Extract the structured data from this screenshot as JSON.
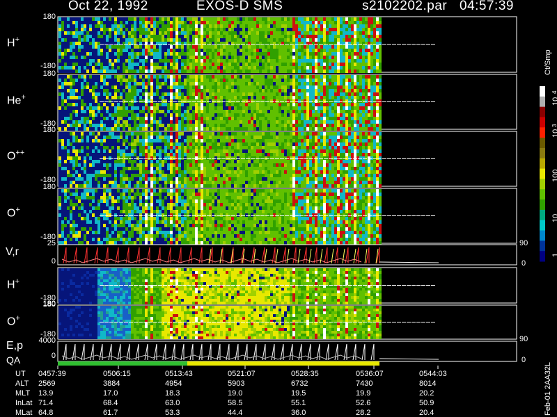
{
  "header": {
    "date": "Oct 22, 1992",
    "instrument": "EXOS-D SMS",
    "file": "s2102202.par",
    "time": "04:57:39"
  },
  "panels": [
    {
      "label": "H",
      "sup": "+",
      "top": "180",
      "bottom": "-180"
    },
    {
      "label": "He",
      "sup": "+",
      "top": "180",
      "bottom": "-180"
    },
    {
      "label": "O",
      "sup": "++",
      "top": "180",
      "bottom": "-180"
    },
    {
      "label": "O",
      "sup": "+",
      "top": "180",
      "bottom": "-180"
    },
    {
      "label": "V,r",
      "sup": "",
      "top": "25",
      "bottom": "0"
    },
    {
      "label": "H",
      "sup": "+",
      "top": "180",
      "bottom": "-180"
    },
    {
      "label": "O",
      "sup": "+",
      "top": "180",
      "bottom": "-180"
    },
    {
      "label": "E,p",
      "sup": "",
      "top": "4000",
      "bottom": "0"
    }
  ],
  "qa_label": "QA",
  "right_axis": {
    "vr_top": "90",
    "vr_bottom": "0",
    "ep_top": "90",
    "ep_bottom": "0"
  },
  "colorbar": {
    "unit": "Ct/Smp",
    "ticks": [
      "10",
      "4",
      "10",
      "3",
      "100",
      "10",
      "1"
    ],
    "colors": [
      "#ffffff",
      "#b0b0b0",
      "#8b0000",
      "#cc0000",
      "#ff2000",
      "#6b5a00",
      "#8a7a10",
      "#b8a800",
      "#e8e800",
      "#a0d000",
      "#60c000",
      "#30a000",
      "#00aa80",
      "#00c8c8",
      "#0088cc",
      "#003399",
      "#000080"
    ]
  },
  "footer_code": "Feb-01 2AA32L",
  "chart_data": {
    "type": "heatmap",
    "title": "Oct 22, 1992   EXOS-D SMS",
    "x_rows": {
      "labels": [
        "UT",
        "ALT",
        "MLT",
        "InLat",
        "MLat"
      ],
      "columns": [
        [
          "0457:39",
          "0506:15",
          "0513:43",
          "0521:07",
          "0528:35",
          "0536:07",
          "0544:03"
        ],
        [
          "2569",
          "3884",
          "4954",
          "5903",
          "6732",
          "7430",
          "8014"
        ],
        [
          "13.9",
          "17.0",
          "18.3",
          "19.0",
          "19.5",
          "19.9",
          "20.2"
        ],
        [
          "71.4",
          "68.4",
          "63.0",
          "58.5",
          "55.1",
          "52.6",
          "50.9"
        ],
        [
          "64.8",
          "61.7",
          "53.3",
          "44.4",
          "36.0",
          "28.2",
          "20.4"
        ]
      ]
    },
    "yrange_pitch": [
      -180,
      180
    ],
    "vr_range": [
      0,
      25
    ],
    "ep_range": [
      0,
      4000
    ],
    "colorscale": "log 1 to 10^4 Ct/Smp"
  }
}
